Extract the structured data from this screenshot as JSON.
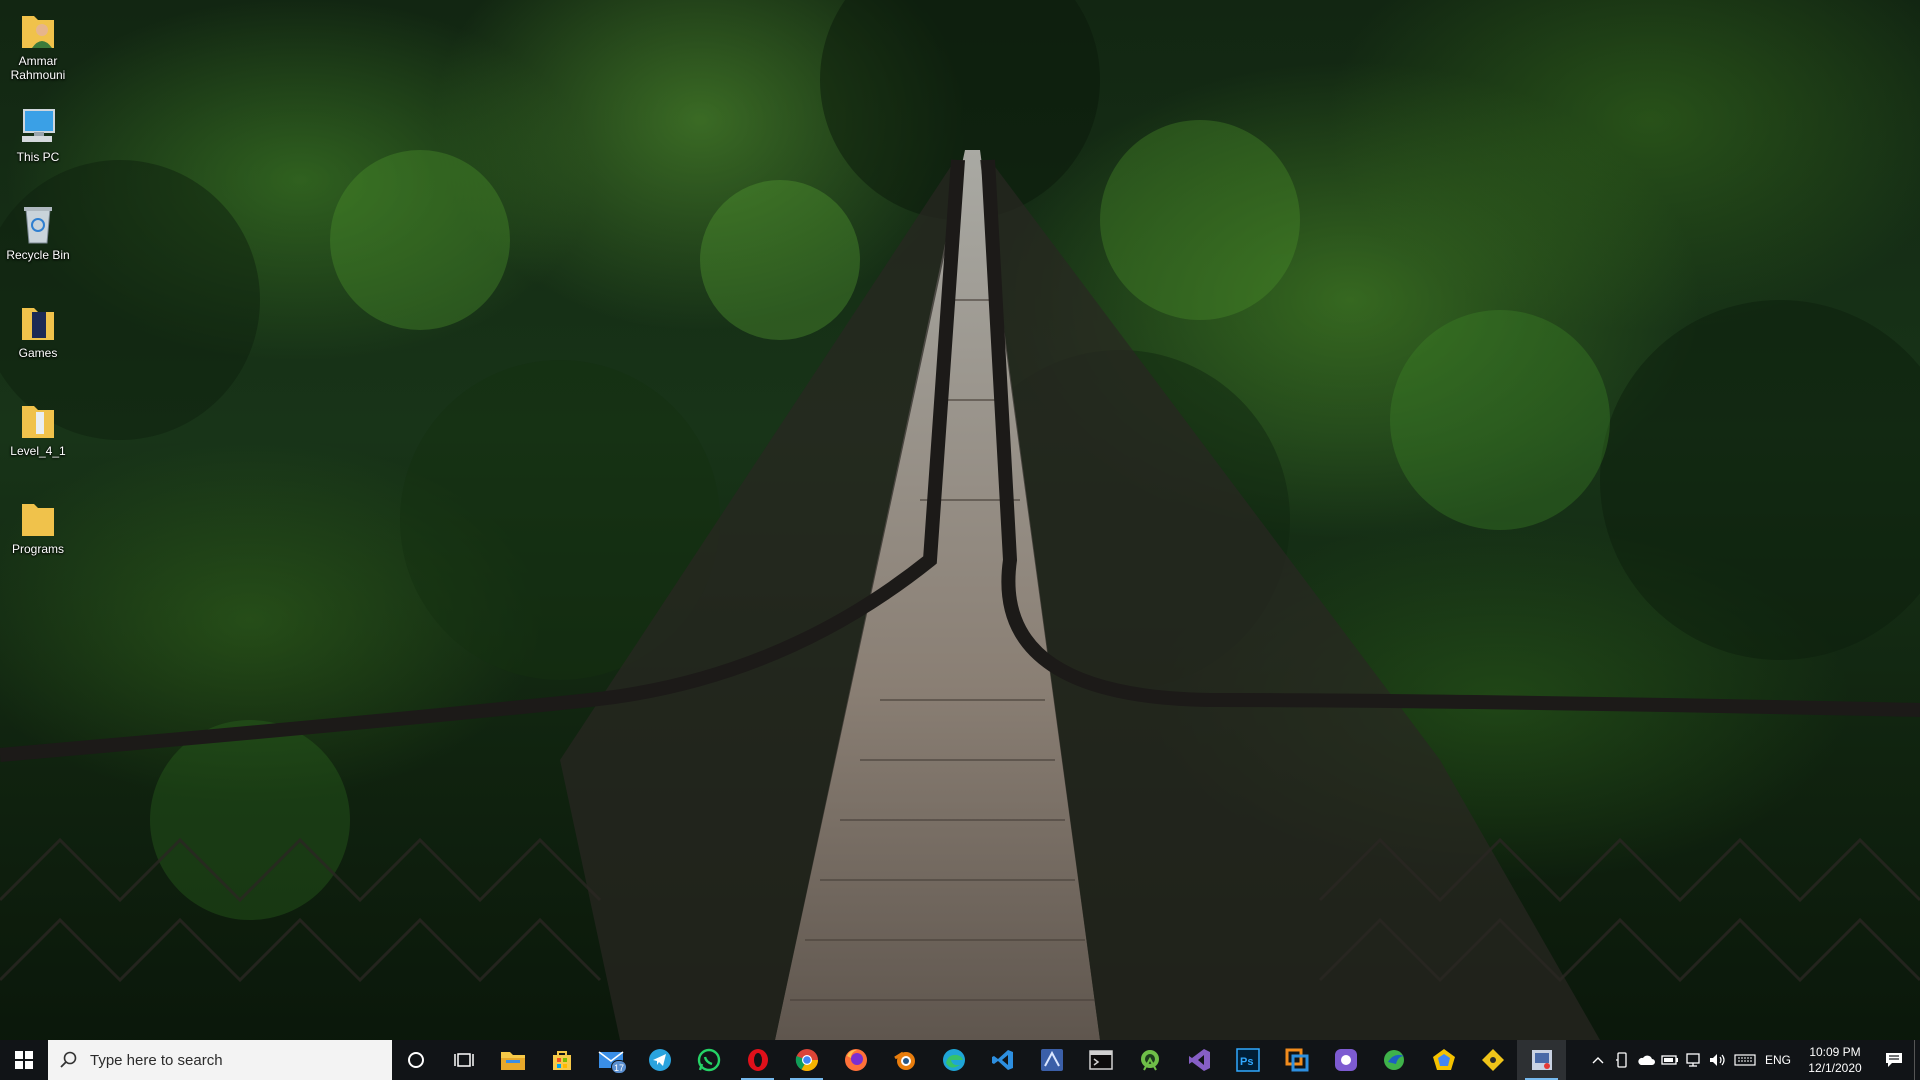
{
  "desktop": {
    "wallpaper": "forest-suspension-bridge",
    "icons": [
      {
        "label": "Ammar Rahmouni",
        "icon": "user-folder-icon"
      },
      {
        "label": "This PC",
        "icon": "this-pc-icon"
      },
      {
        "label": "Recycle Bin",
        "icon": "recycle-bin-icon"
      },
      {
        "label": "Games",
        "icon": "folder-icon"
      },
      {
        "label": "Level_4_1",
        "icon": "folder-icon"
      },
      {
        "label": "Programs",
        "icon": "folder-icon"
      }
    ]
  },
  "taskbar": {
    "search_placeholder": "Type here to search",
    "apps": [
      {
        "name": "file-explorer",
        "icon": "file-explorer-icon",
        "color": "#f7c948",
        "running": false
      },
      {
        "name": "microsoft-store",
        "icon": "store-icon",
        "color": "#f7c948",
        "running": false
      },
      {
        "name": "mail",
        "icon": "mail-icon",
        "color": "#3a8ee6",
        "badge": "17",
        "running": false
      },
      {
        "name": "telegram",
        "icon": "telegram-icon",
        "color": "#2aa3de",
        "running": false
      },
      {
        "name": "whatsapp",
        "icon": "whatsapp-icon",
        "color": "#25d366",
        "running": false
      },
      {
        "name": "opera",
        "icon": "opera-icon",
        "color": "#e0101a",
        "running": true
      },
      {
        "name": "chrome",
        "icon": "chrome-icon",
        "color": "#34a853",
        "running": true
      },
      {
        "name": "firefox",
        "icon": "firefox-icon",
        "color": "#ff7139",
        "running": false
      },
      {
        "name": "blender",
        "icon": "blender-icon",
        "color": "#e87d0d",
        "running": false
      },
      {
        "name": "edge",
        "icon": "edge-icon",
        "color": "#1fa5d6",
        "running": false
      },
      {
        "name": "vscode",
        "icon": "vscode-icon",
        "color": "#2d8fe0",
        "running": false
      },
      {
        "name": "unknown-blue",
        "icon": "app-icon",
        "color": "#3b5fa8",
        "running": false
      },
      {
        "name": "terminal",
        "icon": "terminal-icon",
        "color": "#d0d0d0",
        "running": false
      },
      {
        "name": "android-studio",
        "icon": "android-studio-icon",
        "color": "#6fbf48",
        "running": false
      },
      {
        "name": "visual-studio",
        "icon": "visual-studio-icon",
        "color": "#865fc5",
        "running": false
      },
      {
        "name": "photoshop",
        "icon": "photoshop-icon",
        "color": "#31a8ff",
        "running": false
      },
      {
        "name": "app-orange-blue",
        "icon": "app-icon",
        "color": "#f28c1d",
        "running": false
      },
      {
        "name": "app-purple",
        "icon": "app-icon",
        "color": "#7d5bd1",
        "running": false
      },
      {
        "name": "app-green",
        "icon": "app-icon",
        "color": "#3fb24a",
        "running": false
      },
      {
        "name": "app-yellow",
        "icon": "app-icon",
        "color": "#f5c200",
        "running": false
      },
      {
        "name": "app-git",
        "icon": "app-icon",
        "color": "#f0c419",
        "running": false
      },
      {
        "name": "app-active",
        "icon": "app-icon",
        "color": "#c9d2e3",
        "running": true,
        "active": true
      }
    ],
    "tray": {
      "language": "ENG",
      "time": "10:09 PM",
      "date": "12/1/2020"
    }
  }
}
